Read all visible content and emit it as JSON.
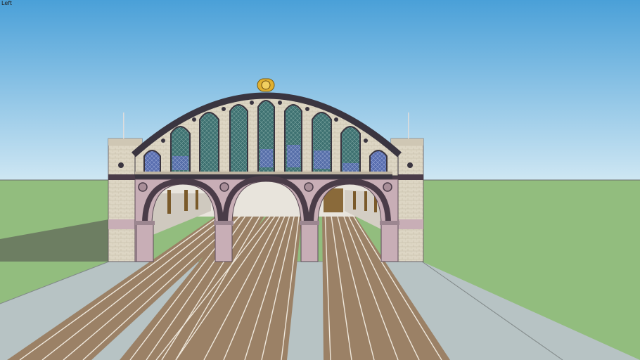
{
  "viewport": {
    "view_label": "Left"
  },
  "colors": {
    "sky_top": "#4a9fd8",
    "sky_bottom": "#c8e3f2",
    "ground": "#92bd7e",
    "platform": "#b2bfc0",
    "track_bed": "#9b8268",
    "rail": "#e6e0d4",
    "facade_stone": "#ddd7c6",
    "arch_trim": "#4a3c48",
    "pier_pink": "#c8aeb6",
    "window_glass": "#3f7370",
    "roof_dark": "#3a3540",
    "clock_gold": "#e0b030"
  }
}
